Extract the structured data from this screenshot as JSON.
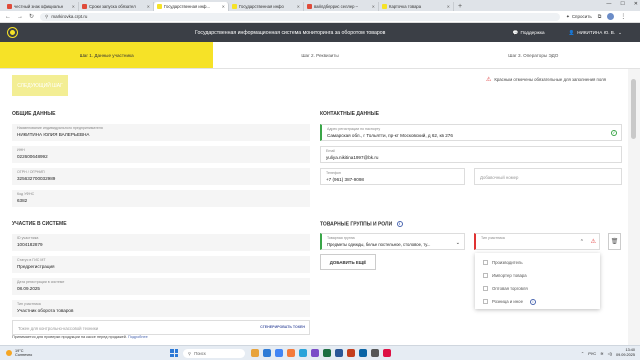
{
  "browser": {
    "tabs": [
      {
        "label": "честный знак официальн",
        "color": "#e04b3a",
        "active": false
      },
      {
        "label": "Сроки запуска обязател",
        "color": "#e04b3a",
        "active": false
      },
      {
        "label": "Государственная инф...",
        "color": "#f6e227",
        "active": true
      },
      {
        "label": "Государственная инфо",
        "color": "#f6e227",
        "active": false
      },
      {
        "label": "вайлдберрис селлер –",
        "color": "#e04b3a",
        "active": false
      },
      {
        "label": "Карточка товара",
        "color": "#f6e227",
        "active": false
      }
    ],
    "new_tab": "+",
    "window_controls": [
      "—",
      "☐",
      "✕"
    ],
    "url": "markirovka.crpt.ru",
    "share_label": "Спросить"
  },
  "header": {
    "title": "Государственная информационная система мониторинга за оборотом товаров",
    "support": "Поддержка",
    "user": "НИКИТИНА Ю. В."
  },
  "steps": [
    {
      "label": "Шаг 1. Данные участника",
      "active": true
    },
    {
      "label": "Шаг 2. Реквизиты",
      "active": false
    },
    {
      "label": "Шаг 3. Операторы ЭДО",
      "active": false
    }
  ],
  "form": {
    "next_button": "СЛЕДУЮЩИЙ ШАГ",
    "required_note": "Красным отмечены обязательные для заполнения поля",
    "general": {
      "title": "ОБЩИЕ ДАННЫЕ",
      "name_label": "Наименование индивидуального предпринимателя",
      "name_value": "НИКИТИНА ЮЛИЯ ВАЛЕРЬЕВНА",
      "inn_label": "ИНН",
      "inn_value": "022600648992",
      "ogrn_label": "ОГРН / ОГРНИП",
      "ogrn_value": "325632700032989",
      "kpp_label": "Код УФНС",
      "kpp_value": "6382"
    },
    "contacts": {
      "title": "КОНТАКТНЫЕ ДАННЫЕ",
      "address_label": "Адрес регистрации по паспорту",
      "address_value": "Самарская обл., г Тольятти, пр-кт Московский, д 62, кв 276",
      "email_label": "Email",
      "email_value": "yuliya.nikitina1997@bk.ru",
      "phone_label": "Телефон",
      "phone_value": "+7 (961) 387-9098",
      "extra_phone_placeholder": "Добавочный номер"
    },
    "participation": {
      "title": "УЧАСТИЕ В СИСТЕМЕ",
      "id_label": "ID участника",
      "id_value": "1004182879",
      "status_label": "Статус в ГИС МТ",
      "status_value": "Предрегистрация",
      "date_label": "Дата регистрации в системе",
      "date_value": "08.09.2025",
      "type_label": "Тип участника",
      "type_value": "Участник оборота товаров",
      "cash_placeholder": "Токен для контрольно-кассовой техники",
      "cash_link": "СГЕНЕРИРОВАТЬ ТОКЕН"
    },
    "groups": {
      "title": "ТОВАРНЫЕ ГРУППЫ И РОЛИ",
      "group_label": "Товарная группа",
      "group_value": "Предметы одежды, белье постельное, столовое, ту...",
      "role_label": "Тип участника",
      "add_button": "ДОБАВИТЬ ЕЩЁ",
      "role_options": [
        "Производитель",
        "Импортер товара",
        "Оптовая торговля",
        "Розница и иное"
      ]
    },
    "bottom_note": "Принимается для проверки продукции на кассе перед продажей",
    "bottom_link": "Подробнее"
  },
  "taskbar": {
    "temp": "19°C",
    "weather": "Солнечно",
    "search": "Поиск",
    "lang": "РУС",
    "time": "13:40",
    "date": "09.09.2025"
  }
}
